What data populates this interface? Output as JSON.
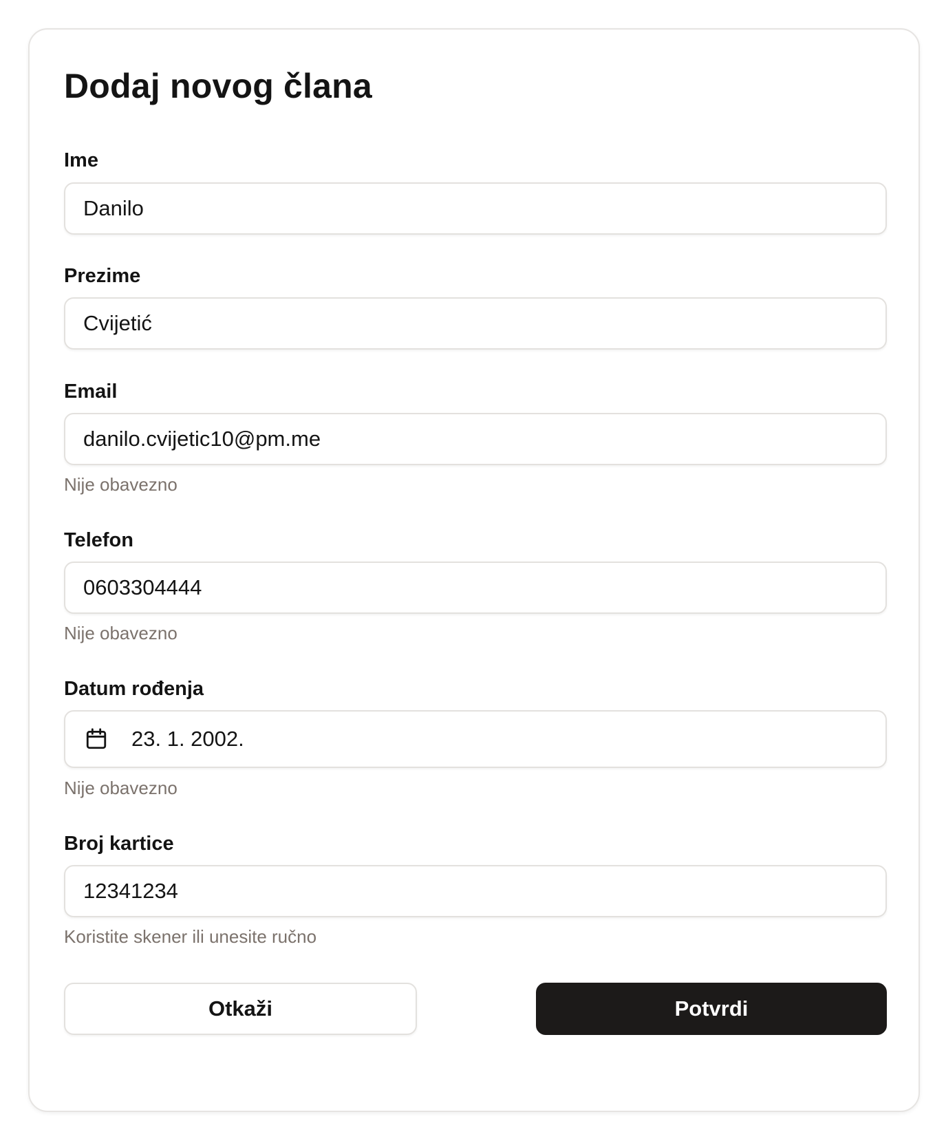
{
  "dialog": {
    "title": "Dodaj novog člana"
  },
  "fields": {
    "first_name": {
      "label": "Ime",
      "value": "Danilo"
    },
    "last_name": {
      "label": "Prezime",
      "value": "Cvijetić"
    },
    "email": {
      "label": "Email",
      "value": "danilo.cvijetic10@pm.me",
      "hint": "Nije obavezno"
    },
    "phone": {
      "label": "Telefon",
      "value": "0603304444",
      "hint": "Nije obavezno"
    },
    "birth_date": {
      "label": "Datum rođenja",
      "value": "23. 1. 2002.",
      "hint": "Nije obavezno",
      "icon": "calendar-icon"
    },
    "card_number": {
      "label": "Broj kartice",
      "value": "12341234",
      "hint": "Koristite skener ili unesite ručno"
    }
  },
  "actions": {
    "cancel_label": "Otkaži",
    "confirm_label": "Potvrdi"
  },
  "colors": {
    "text": "#141414",
    "hint": "#7b726c",
    "border": "#e3e1de",
    "primary_button": "#1c1a19"
  }
}
